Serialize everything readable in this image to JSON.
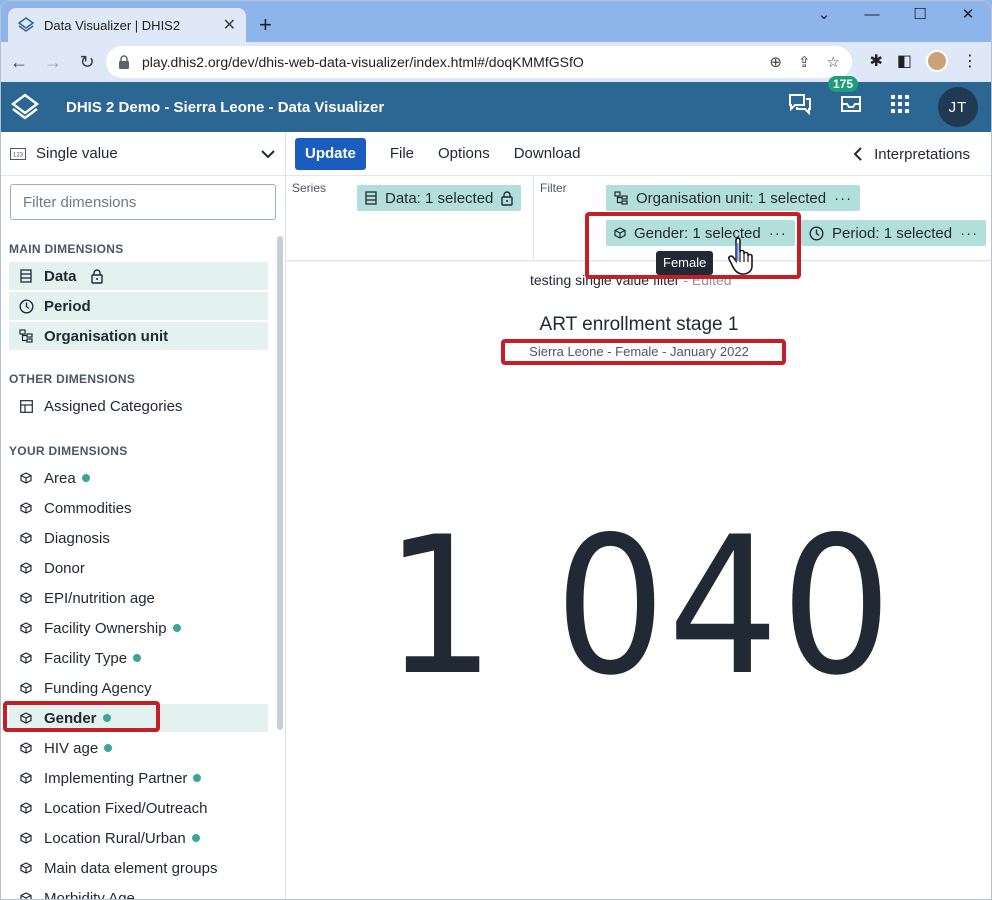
{
  "browser": {
    "tab_title": "Data Visualizer | DHIS2",
    "url": "play.dhis2.org/dev/dhis-web-data-visualizer/index.html#/doqKMMfGSfO"
  },
  "app": {
    "title": "DHIS 2 Demo - Sierra Leone - Data Visualizer",
    "messages_count": "175",
    "user_initials": "JT",
    "brand_color": "#2c6693"
  },
  "left_panel": {
    "vis_type": "Single value",
    "filter_placeholder": "Filter dimensions",
    "main_title": "MAIN DIMENSIONS",
    "main": [
      {
        "label": "Data",
        "icon": "data-icon"
      },
      {
        "label": "Period",
        "icon": "clock-icon"
      },
      {
        "label": "Organisation unit",
        "icon": "org-unit-icon"
      }
    ],
    "other_title": "OTHER DIMENSIONS",
    "other": [
      {
        "label": "Assigned Categories"
      }
    ],
    "your_title": "YOUR DIMENSIONS",
    "your": [
      {
        "label": "Area",
        "dot": true
      },
      {
        "label": "Commodities",
        "dot": false
      },
      {
        "label": "Diagnosis",
        "dot": false
      },
      {
        "label": "Donor",
        "dot": false
      },
      {
        "label": "EPI/nutrition age",
        "dot": false
      },
      {
        "label": "Facility Ownership",
        "dot": true
      },
      {
        "label": "Facility Type",
        "dot": true
      },
      {
        "label": "Funding Agency",
        "dot": false
      },
      {
        "label": "Gender",
        "dot": true
      },
      {
        "label": "HIV age",
        "dot": true
      },
      {
        "label": "Implementing Partner",
        "dot": true
      },
      {
        "label": "Location Fixed/Outreach",
        "dot": false
      },
      {
        "label": "Location Rural/Urban",
        "dot": true
      },
      {
        "label": "Main data element groups",
        "dot": false
      },
      {
        "label": "Morbidity Age",
        "dot": false
      }
    ]
  },
  "toolbar": {
    "update": "Update",
    "file": "File",
    "options": "Options",
    "download": "Download",
    "interpretations": "Interpretations"
  },
  "layout": {
    "series_label": "Series",
    "filter_label": "Filter",
    "data_chip": "Data: 1 selected",
    "org_chip": "Organisation unit: 1 selected",
    "gender_chip": "Gender: 1 selected",
    "period_chip": "Period: 1 selected",
    "tooltip": "Female"
  },
  "visualization": {
    "name": "testing single value filter",
    "edited": " - Edited",
    "title": "ART enrollment stage 1",
    "subtitle": "Sierra Leone - Female - January 2022",
    "value": "1 040"
  }
}
